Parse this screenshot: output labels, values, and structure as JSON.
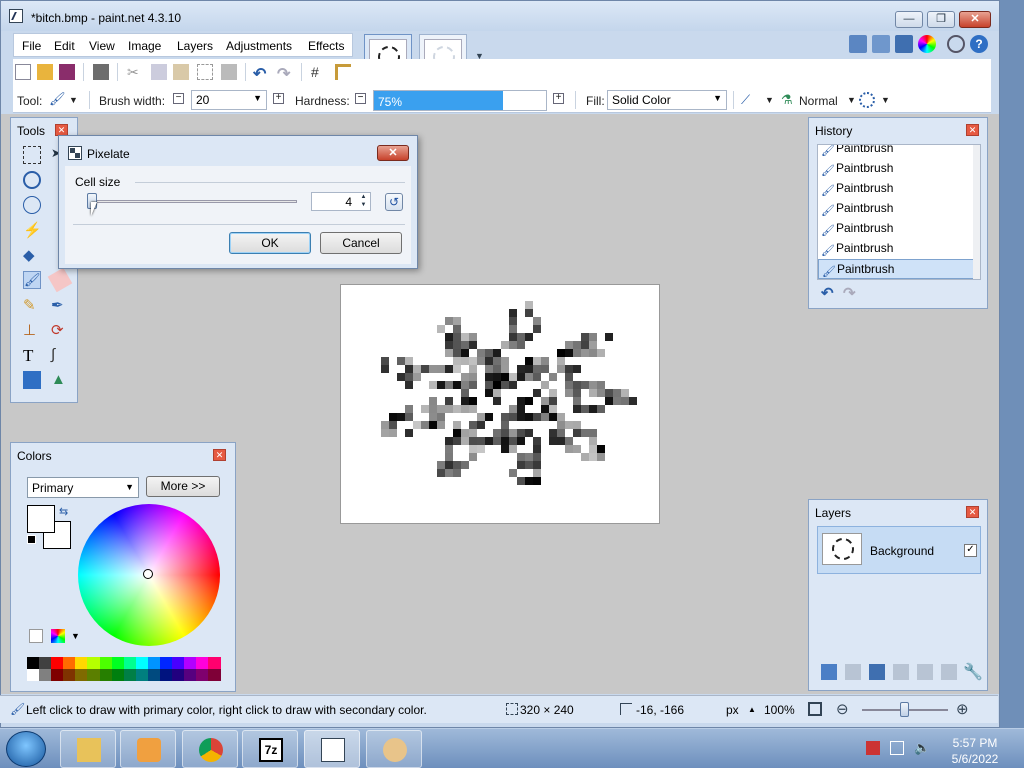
{
  "window": {
    "title": "*bitch.bmp - paint.net 4.3.10",
    "min": "—",
    "max": "❐",
    "close": "✕"
  },
  "menu": [
    "File",
    "Edit",
    "View",
    "Image",
    "Layers",
    "Adjustments",
    "Effects"
  ],
  "toolbar": {
    "tool_label": "Tool:",
    "brush_width_label": "Brush width:",
    "brush_width_value": "20",
    "hardness_label": "Hardness:",
    "hardness_value": "75%",
    "hardness_fraction": 0.75,
    "fill_label": "Fill:",
    "fill_value": "Solid Color",
    "blend_value": "Normal"
  },
  "tools_panel": {
    "title": "Tools"
  },
  "history_panel": {
    "title": "History",
    "items": [
      "Paintbrush",
      "Paintbrush",
      "Paintbrush",
      "Paintbrush",
      "Paintbrush",
      "Paintbrush",
      "Paintbrush"
    ]
  },
  "colors_panel": {
    "title": "Colors",
    "mode": "Primary",
    "more_button": "More >>",
    "palette": [
      "#000000",
      "#404040",
      "#ff0000",
      "#ff6a00",
      "#ffd800",
      "#b6ff00",
      "#4cff00",
      "#00ff21",
      "#00ff90",
      "#00ffff",
      "#0094ff",
      "#0026ff",
      "#4800ff",
      "#b200ff",
      "#ff00dc",
      "#ff006e",
      "#ffffff",
      "#808080",
      "#7f0000",
      "#7f3300",
      "#7f6a00",
      "#5b7f00",
      "#267f00",
      "#007f0e",
      "#007f46",
      "#007f7f",
      "#004a7f",
      "#00137f",
      "#21007f",
      "#57007f",
      "#7f006e",
      "#7f0037"
    ]
  },
  "layers_panel": {
    "title": "Layers",
    "layer_name": "Background",
    "visible_check": "✓"
  },
  "dialog": {
    "title": "Pixelate",
    "cell_size_label": "Cell size",
    "cell_size_value": "4",
    "ok": "OK",
    "cancel": "Cancel",
    "close": "✕"
  },
  "status": {
    "hint": "Left click to draw with primary color, right click to draw with secondary color.",
    "image_size": "320 × 240",
    "cursor_pos": "-16, -166",
    "unit": "px",
    "zoom": "100%"
  },
  "taskbar": {
    "time": "5:57 PM",
    "date": "5/6/2022"
  }
}
